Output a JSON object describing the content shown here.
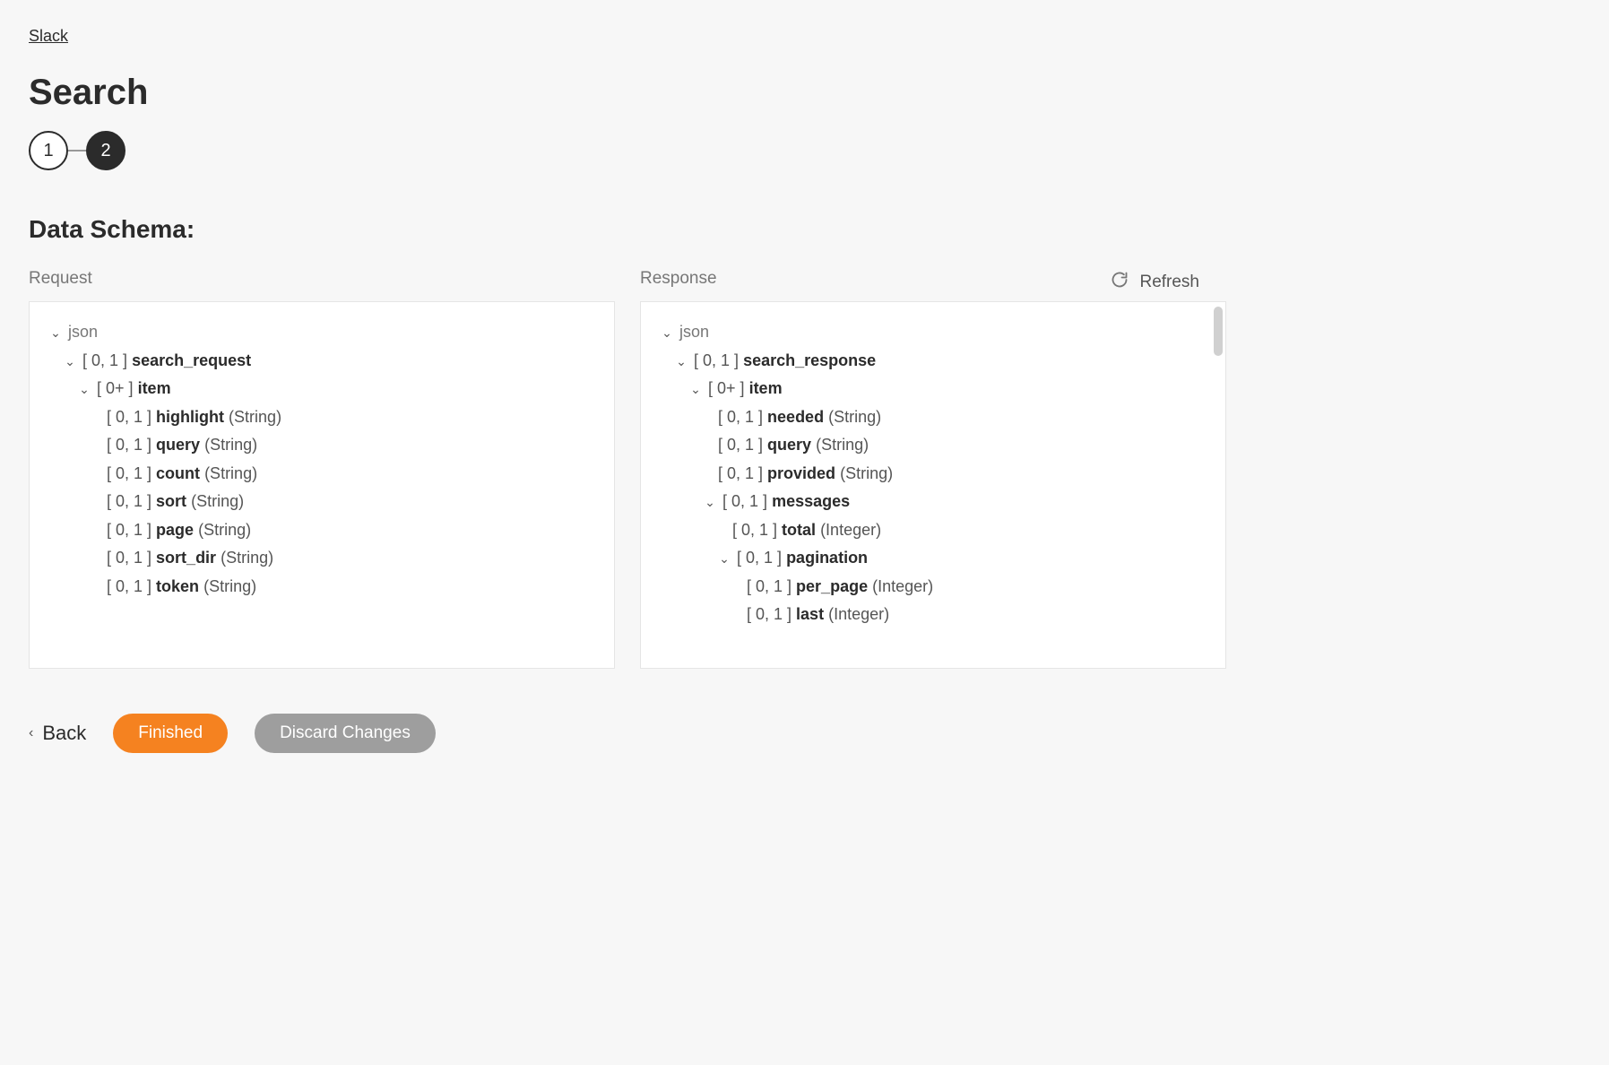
{
  "breadcrumb": "Slack",
  "page_title": "Search",
  "stepper": {
    "step1": "1",
    "step2": "2"
  },
  "section_title": "Data Schema:",
  "refresh_label": "Refresh",
  "request_label": "Request",
  "response_label": "Response",
  "root_label": "json",
  "back_label": "Back",
  "finished_label": "Finished",
  "discard_label": "Discard Changes",
  "request_tree": {
    "root_card": "[ 0, 1 ]",
    "root_name": "search_request",
    "item_card": "[ 0+ ]",
    "item_name": "item",
    "fields": [
      {
        "card": "[ 0, 1 ]",
        "name": "highlight",
        "type": "(String)"
      },
      {
        "card": "[ 0, 1 ]",
        "name": "query",
        "type": "(String)"
      },
      {
        "card": "[ 0, 1 ]",
        "name": "count",
        "type": "(String)"
      },
      {
        "card": "[ 0, 1 ]",
        "name": "sort",
        "type": "(String)"
      },
      {
        "card": "[ 0, 1 ]",
        "name": "page",
        "type": "(String)"
      },
      {
        "card": "[ 0, 1 ]",
        "name": "sort_dir",
        "type": "(String)"
      },
      {
        "card": "[ 0, 1 ]",
        "name": "token",
        "type": "(String)"
      }
    ]
  },
  "response_tree": {
    "root_card": "[ 0, 1 ]",
    "root_name": "search_response",
    "item_card": "[ 0+ ]",
    "item_name": "item",
    "fields": [
      {
        "card": "[ 0, 1 ]",
        "name": "needed",
        "type": "(String)"
      },
      {
        "card": "[ 0, 1 ]",
        "name": "query",
        "type": "(String)"
      },
      {
        "card": "[ 0, 1 ]",
        "name": "provided",
        "type": "(String)"
      }
    ],
    "messages_card": "[ 0, 1 ]",
    "messages_name": "messages",
    "total_card": "[ 0, 1 ]",
    "total_name": "total",
    "total_type": "(Integer)",
    "pagination_card": "[ 0, 1 ]",
    "pagination_name": "pagination",
    "pagination_fields": [
      {
        "card": "[ 0, 1 ]",
        "name": "per_page",
        "type": "(Integer)"
      },
      {
        "card": "[ 0, 1 ]",
        "name": "last",
        "type": "(Integer)"
      }
    ]
  }
}
